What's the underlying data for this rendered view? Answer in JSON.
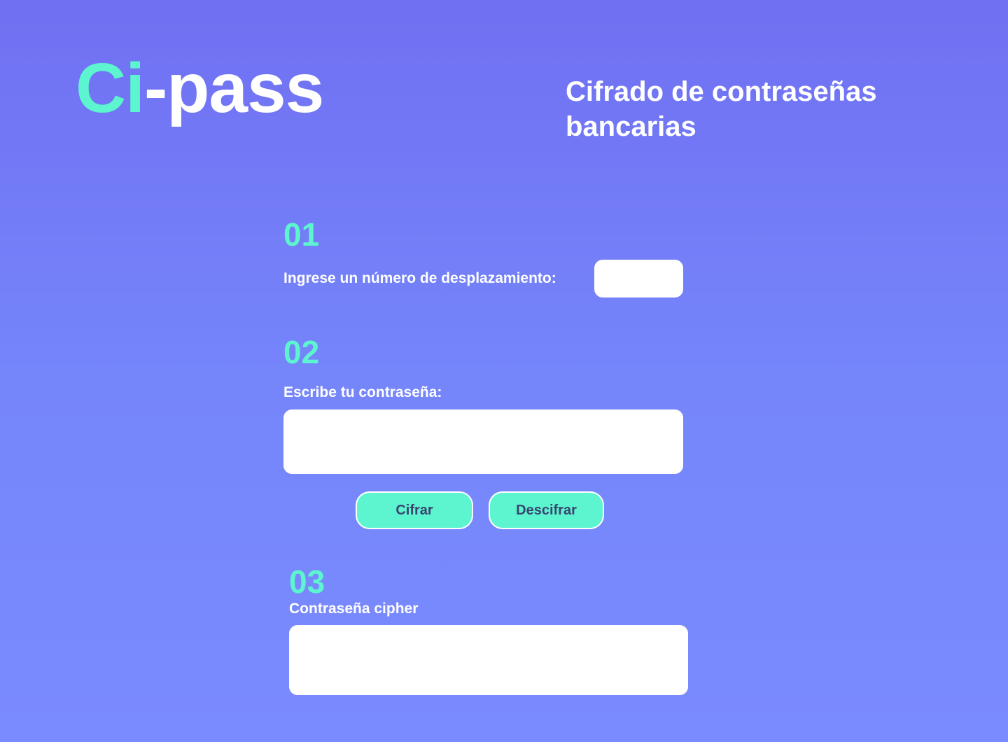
{
  "header": {
    "logo_accent": "Ci",
    "logo_rest": "-pass",
    "subtitle": "Cifrado de contraseñas bancarias"
  },
  "step1": {
    "number": "01",
    "label": "Ingrese un número de desplazamiento:",
    "offset_value": "",
    "offset_placeholder": ""
  },
  "step2": {
    "number": "02",
    "label": "Escribe tu contraseña:",
    "password_value": "",
    "password_placeholder": ""
  },
  "actions": {
    "encrypt_label": "Cifrar",
    "decrypt_label": "Descifrar"
  },
  "step3": {
    "number": "03",
    "label": "Contraseña cipher",
    "output_value": ""
  },
  "colors": {
    "accent": "#5cf5cf",
    "background_top": "#7070f2",
    "background_bottom": "#7a8bff",
    "button_text": "#3a4470"
  }
}
